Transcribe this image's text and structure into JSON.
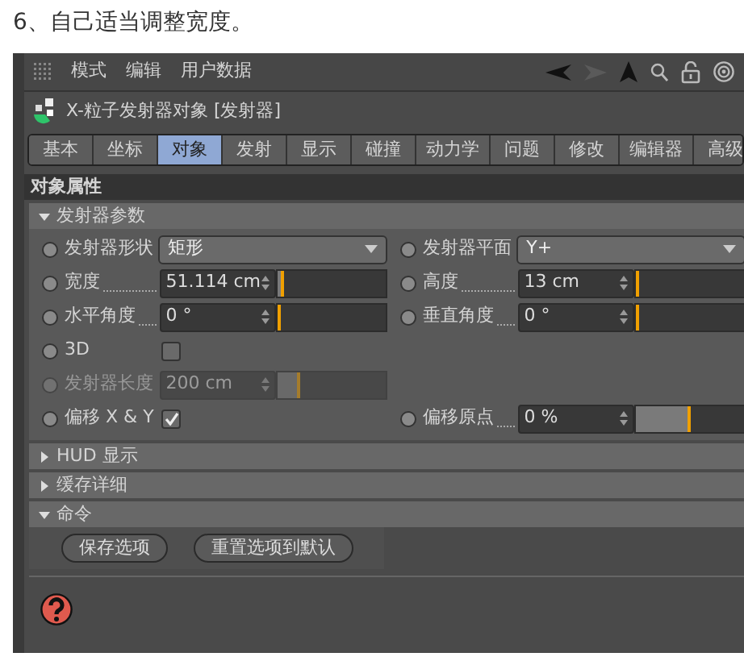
{
  "caption": "6、自己适当调整宽度。",
  "menu": [
    "模式",
    "编辑",
    "用户数据"
  ],
  "object_title": "X-粒子发射器对象 [发射器]",
  "tabs": [
    {
      "label": "基本",
      "selected": false
    },
    {
      "label": "坐标",
      "selected": false
    },
    {
      "label": "对象",
      "selected": true
    },
    {
      "label": "发射",
      "selected": false
    },
    {
      "label": "显示",
      "selected": false
    },
    {
      "label": "碰撞",
      "selected": false
    },
    {
      "label": "动力学",
      "selected": false
    },
    {
      "label": "问题",
      "selected": false
    },
    {
      "label": "修改",
      "selected": false
    },
    {
      "label": "编辑器",
      "selected": false
    },
    {
      "label": "高级",
      "selected": false
    }
  ],
  "section_title": "对象属性",
  "groups": [
    {
      "title": "发射器参数",
      "expanded": true,
      "rows": [
        [
          {
            "label": "发射器形状",
            "kind": "dropdown",
            "value": "矩形"
          },
          {
            "label": "发射器平面",
            "kind": "dropdown",
            "value": "Y+"
          }
        ],
        [
          {
            "label": "宽度",
            "kind": "number",
            "value": "51.114 cm",
            "level": 0.05
          },
          {
            "label": "高度",
            "kind": "number",
            "value": "13 cm",
            "level": 0
          }
        ],
        [
          {
            "label": "水平角度",
            "kind": "number",
            "value": "0 °",
            "level": 0
          },
          {
            "label": "垂直角度",
            "kind": "number",
            "value": "0 °",
            "level": 0
          }
        ],
        [
          {
            "label": "3D",
            "kind": "checkbox",
            "checked": false
          }
        ],
        [
          {
            "label": "发射器长度",
            "kind": "number",
            "value": "200 cm",
            "level": 0.2,
            "disabled": true
          }
        ],
        [
          {
            "label": "偏移 X & Y",
            "kind": "checkbox",
            "checked": true
          },
          {
            "label": "偏移原点",
            "kind": "number",
            "value": "0 %",
            "level": 0.5
          }
        ]
      ]
    },
    {
      "title": "HUD 显示",
      "expanded": false
    },
    {
      "title": "缓存详细",
      "expanded": false
    },
    {
      "title": "命令",
      "expanded": true,
      "buttons": [
        "保存选项",
        "重置选项到默认"
      ]
    }
  ]
}
